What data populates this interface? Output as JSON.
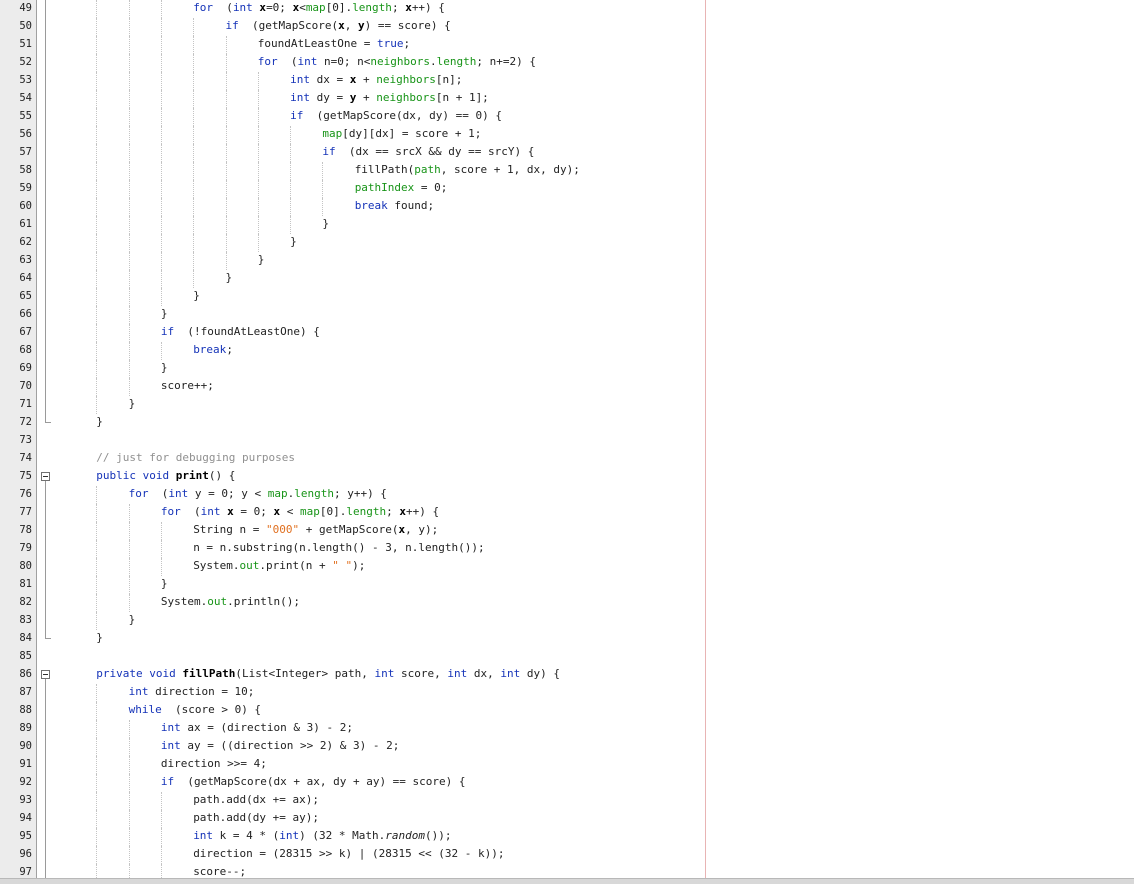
{
  "editor": {
    "lines": [
      {
        "n": "49",
        "indent": 4,
        "tokens": [
          [
            "kw",
            "for"
          ],
          [
            "",
            "  ("
          ],
          [
            "kw",
            "int"
          ],
          [
            "bold",
            " x"
          ],
          [
            "",
            "=0; "
          ],
          [
            "bold",
            "x"
          ],
          [
            "",
            "<"
          ],
          [
            "fld",
            "map"
          ],
          [
            "",
            "[0]."
          ],
          [
            "fld",
            "length"
          ],
          [
            "",
            "; "
          ],
          [
            "bold",
            "x"
          ],
          [
            "",
            "++) {"
          ]
        ]
      },
      {
        "n": "50",
        "indent": 5,
        "tokens": [
          [
            "kw",
            "if"
          ],
          [
            "",
            "  (getMapScore("
          ],
          [
            "bold",
            "x"
          ],
          [
            "",
            ", "
          ],
          [
            "bold",
            "y"
          ],
          [
            "",
            ") == score) {"
          ]
        ]
      },
      {
        "n": "51",
        "indent": 6,
        "tokens": [
          [
            "",
            "foundAtLeastOne = "
          ],
          [
            "kw",
            "true"
          ],
          [
            "",
            ";"
          ]
        ]
      },
      {
        "n": "52",
        "indent": 6,
        "tokens": [
          [
            "kw",
            "for"
          ],
          [
            "",
            "  ("
          ],
          [
            "kw",
            "int"
          ],
          [
            "",
            " n=0; n<"
          ],
          [
            "fld",
            "neighbors"
          ],
          [
            "",
            "."
          ],
          [
            "fld",
            "length"
          ],
          [
            "",
            "; n+=2) {"
          ]
        ]
      },
      {
        "n": "53",
        "indent": 7,
        "tokens": [
          [
            "kw",
            "int"
          ],
          [
            "",
            " dx = "
          ],
          [
            "bold",
            "x"
          ],
          [
            "",
            " + "
          ],
          [
            "fld",
            "neighbors"
          ],
          [
            "",
            "[n];"
          ]
        ]
      },
      {
        "n": "54",
        "indent": 7,
        "tokens": [
          [
            "kw",
            "int"
          ],
          [
            "",
            " dy = "
          ],
          [
            "bold",
            "y"
          ],
          [
            "",
            " + "
          ],
          [
            "fld",
            "neighbors"
          ],
          [
            "",
            "[n + 1];"
          ]
        ]
      },
      {
        "n": "55",
        "indent": 7,
        "tokens": [
          [
            "kw",
            "if"
          ],
          [
            "",
            "  (getMapScore(dx, dy) == 0) {"
          ]
        ]
      },
      {
        "n": "56",
        "indent": 8,
        "tokens": [
          [
            "fld",
            "map"
          ],
          [
            "",
            "[dy][dx] = score + 1;"
          ]
        ]
      },
      {
        "n": "57",
        "indent": 8,
        "tokens": [
          [
            "kw",
            "if"
          ],
          [
            "",
            "  (dx == srcX && dy == srcY) {"
          ]
        ]
      },
      {
        "n": "58",
        "indent": 9,
        "tokens": [
          [
            "",
            "fillPath("
          ],
          [
            "fld",
            "path"
          ],
          [
            "",
            ", score + 1, dx, dy);"
          ]
        ]
      },
      {
        "n": "59",
        "indent": 9,
        "tokens": [
          [
            "fld",
            "pathIndex"
          ],
          [
            "",
            " = 0;"
          ]
        ]
      },
      {
        "n": "60",
        "indent": 9,
        "tokens": [
          [
            "kw",
            "break"
          ],
          [
            "",
            " found;"
          ]
        ]
      },
      {
        "n": "61",
        "indent": 8,
        "tokens": [
          [
            "",
            "}"
          ]
        ]
      },
      {
        "n": "62",
        "indent": 7,
        "tokens": [
          [
            "",
            "}"
          ]
        ]
      },
      {
        "n": "63",
        "indent": 6,
        "tokens": [
          [
            "",
            "}"
          ]
        ]
      },
      {
        "n": "64",
        "indent": 5,
        "tokens": [
          [
            "",
            "}"
          ]
        ]
      },
      {
        "n": "65",
        "indent": 4,
        "tokens": [
          [
            "",
            "}"
          ]
        ]
      },
      {
        "n": "66",
        "indent": 3,
        "tokens": [
          [
            "",
            "}"
          ]
        ]
      },
      {
        "n": "67",
        "indent": 3,
        "tokens": [
          [
            "kw",
            "if"
          ],
          [
            "",
            "  (!foundAtLeastOne) {"
          ]
        ]
      },
      {
        "n": "68",
        "indent": 4,
        "tokens": [
          [
            "kw",
            "break"
          ],
          [
            "",
            ";"
          ]
        ]
      },
      {
        "n": "69",
        "indent": 3,
        "tokens": [
          [
            "",
            "}"
          ]
        ]
      },
      {
        "n": "70",
        "indent": 3,
        "tokens": [
          [
            "",
            "score++;"
          ]
        ]
      },
      {
        "n": "71",
        "indent": 2,
        "tokens": [
          [
            "",
            "}"
          ]
        ]
      },
      {
        "n": "72",
        "indent": 1,
        "tokens": [
          [
            "",
            "}"
          ]
        ]
      },
      {
        "n": "73",
        "indent": 0,
        "tokens": []
      },
      {
        "n": "74",
        "indent": 1,
        "tokens": [
          [
            "com",
            "// just for debugging purposes"
          ]
        ]
      },
      {
        "n": "75",
        "indent": 1,
        "tokens": [
          [
            "kw",
            "public"
          ],
          [
            "",
            " "
          ],
          [
            "kw",
            "void"
          ],
          [
            "",
            " "
          ],
          [
            "bold",
            "print"
          ],
          [
            "",
            "() {"
          ]
        ]
      },
      {
        "n": "76",
        "indent": 2,
        "tokens": [
          [
            "kw",
            "for"
          ],
          [
            "",
            "  ("
          ],
          [
            "kw",
            "int"
          ],
          [
            "",
            " y = 0; y < "
          ],
          [
            "fld",
            "map"
          ],
          [
            "",
            "."
          ],
          [
            "fld",
            "length"
          ],
          [
            "",
            "; y++) {"
          ]
        ]
      },
      {
        "n": "77",
        "indent": 3,
        "tokens": [
          [
            "kw",
            "for"
          ],
          [
            "",
            "  ("
          ],
          [
            "kw",
            "int"
          ],
          [
            "",
            " "
          ],
          [
            "bold",
            "x"
          ],
          [
            "",
            " = 0; "
          ],
          [
            "bold",
            "x"
          ],
          [
            "",
            " < "
          ],
          [
            "fld",
            "map"
          ],
          [
            "",
            "[0]."
          ],
          [
            "fld",
            "length"
          ],
          [
            "",
            "; "
          ],
          [
            "bold",
            "x"
          ],
          [
            "",
            "++) {"
          ]
        ]
      },
      {
        "n": "78",
        "indent": 4,
        "tokens": [
          [
            "",
            "String n = "
          ],
          [
            "str",
            "\"000\""
          ],
          [
            "",
            " + getMapScore("
          ],
          [
            "bold",
            "x"
          ],
          [
            "",
            ", y);"
          ]
        ]
      },
      {
        "n": "79",
        "indent": 4,
        "tokens": [
          [
            "",
            "n = n.substring(n.length() - 3, n.length());"
          ]
        ]
      },
      {
        "n": "80",
        "indent": 4,
        "tokens": [
          [
            "",
            "System."
          ],
          [
            "fld",
            "out"
          ],
          [
            "",
            ".print(n + "
          ],
          [
            "str",
            "\" \""
          ],
          [
            "",
            ");"
          ]
        ]
      },
      {
        "n": "81",
        "indent": 3,
        "tokens": [
          [
            "",
            "}"
          ]
        ]
      },
      {
        "n": "82",
        "indent": 3,
        "tokens": [
          [
            "",
            "System."
          ],
          [
            "fld",
            "out"
          ],
          [
            "",
            ".println();"
          ]
        ]
      },
      {
        "n": "83",
        "indent": 2,
        "tokens": [
          [
            "",
            "}"
          ]
        ]
      },
      {
        "n": "84",
        "indent": 1,
        "tokens": [
          [
            "",
            "}"
          ]
        ]
      },
      {
        "n": "85",
        "indent": 0,
        "tokens": []
      },
      {
        "n": "86",
        "indent": 1,
        "tokens": [
          [
            "kw",
            "private"
          ],
          [
            "",
            " "
          ],
          [
            "kw",
            "void"
          ],
          [
            "",
            " "
          ],
          [
            "bold",
            "fillPath"
          ],
          [
            "",
            "(List<Integer> path, "
          ],
          [
            "kw",
            "int"
          ],
          [
            "",
            " score, "
          ],
          [
            "kw",
            "int"
          ],
          [
            "",
            " dx, "
          ],
          [
            "kw",
            "int"
          ],
          [
            "",
            " dy) {"
          ]
        ]
      },
      {
        "n": "87",
        "indent": 2,
        "tokens": [
          [
            "kw",
            "int"
          ],
          [
            "",
            " direction = 10;"
          ]
        ]
      },
      {
        "n": "88",
        "indent": 2,
        "tokens": [
          [
            "kw",
            "while"
          ],
          [
            "",
            "  (score > 0) {"
          ]
        ]
      },
      {
        "n": "89",
        "indent": 3,
        "tokens": [
          [
            "kw",
            "int"
          ],
          [
            "",
            " ax = (direction & 3) - 2;"
          ]
        ]
      },
      {
        "n": "90",
        "indent": 3,
        "tokens": [
          [
            "kw",
            "int"
          ],
          [
            "",
            " ay = ((direction >> 2) & 3) - 2;"
          ]
        ]
      },
      {
        "n": "91",
        "indent": 3,
        "tokens": [
          [
            "",
            "direction >>= 4;"
          ]
        ]
      },
      {
        "n": "92",
        "indent": 3,
        "tokens": [
          [
            "kw",
            "if"
          ],
          [
            "",
            "  (getMapScore(dx + ax, dy + ay) == score) {"
          ]
        ]
      },
      {
        "n": "93",
        "indent": 4,
        "tokens": [
          [
            "",
            "path.add(dx += ax);"
          ]
        ]
      },
      {
        "n": "94",
        "indent": 4,
        "tokens": [
          [
            "",
            "path.add(dy += ay);"
          ]
        ]
      },
      {
        "n": "95",
        "indent": 4,
        "tokens": [
          [
            "kw",
            "int"
          ],
          [
            "",
            " k = 4 * ("
          ],
          [
            "kw",
            "int"
          ],
          [
            "",
            ") (32 * Math."
          ],
          [
            "ital",
            "random"
          ],
          [
            "",
            "());"
          ]
        ]
      },
      {
        "n": "96",
        "indent": 4,
        "tokens": [
          [
            "",
            "direction = (28315 >> k) | (28315 << (32 - k));"
          ]
        ]
      },
      {
        "n": "97",
        "indent": 4,
        "tokens": [
          [
            "",
            "score--;"
          ]
        ]
      }
    ],
    "fold_markers": [
      "75",
      "86"
    ],
    "fold_ends": [
      "72",
      "84"
    ]
  }
}
